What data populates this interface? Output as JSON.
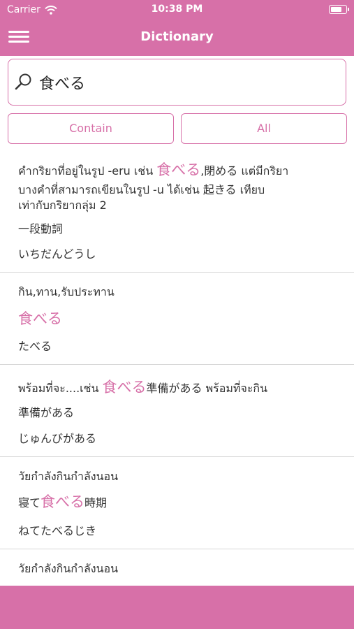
{
  "status": {
    "carrier": "Carrier",
    "time": "10:38 PM"
  },
  "nav": {
    "title": "Dictionary"
  },
  "search": {
    "value": "食べる",
    "placeholder": ""
  },
  "filters": {
    "contain": "Contain",
    "all": "All"
  },
  "entries": [
    {
      "meaning_line1_pre": "คำกริยาที่อยู่ในรูป -eru เช่น ",
      "meaning_line1_hl": "食べる",
      "meaning_line1_post": ",閉める แต่มีกริยา",
      "meaning_line2": "บางคำที่สามารถเขียนในรูป -u ได้เช่น 起きる เทียบ",
      "meaning_line3": "เท่ากับกริยากลุ่ม 2",
      "kanji": "一段動詞",
      "reading": "いちだんどうし"
    },
    {
      "meaning": "กิน,ทาน,รับประทาน",
      "kanji_hl": "食べる",
      "reading": "たべる"
    },
    {
      "meaning_pre": "พร้อมที่จะ....เช่น  ",
      "meaning_hl": "食べる",
      "meaning_post": "準備がある   พร้อมที่จะกิน",
      "kanji": "準備がある",
      "reading": "じゅんびがある"
    },
    {
      "meaning": "วัยกำลังกินกำลังนอน",
      "kanji_pre": "寝て",
      "kanji_hl": "食べる",
      "kanji_post": "時期",
      "reading": "ねてたべるじき"
    },
    {
      "meaning": "วัยกำลังกินกำลังนอน"
    }
  ],
  "colors": {
    "accent": "#d770a8",
    "divider": "#d6d6d6"
  }
}
